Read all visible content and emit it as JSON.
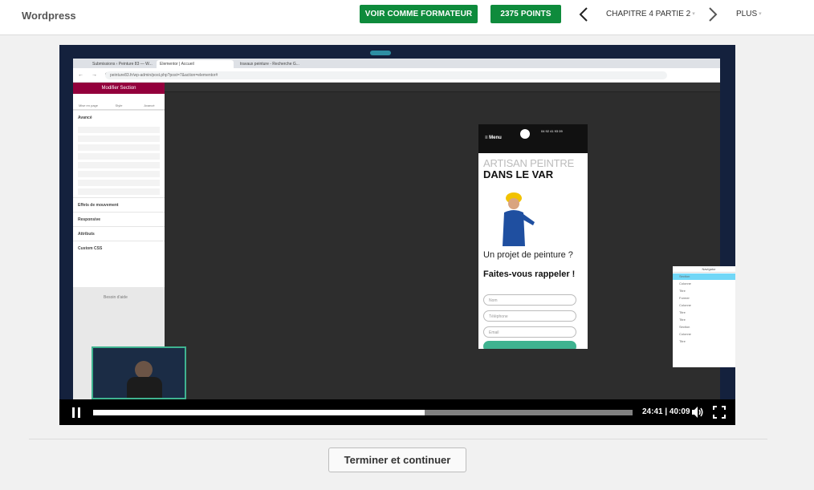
{
  "header": {
    "brand": "Wordpress",
    "trainer_button": "VOIR COMME FORMATEUR",
    "points_button": "2375 POINTS",
    "chapter_label": "CHAPITRE 4 PARTIE 2",
    "more_label": "PLUS"
  },
  "video": {
    "current_time": "24:41",
    "duration": "40:09",
    "time_display": "24:41 | 40:09",
    "progress": 0.615,
    "screen": {
      "tabs": [
        "Submissions ‹ Peinture 83 — W...",
        "Elementor | Accueil",
        "travaux peinture - Recherche G..."
      ],
      "url": "peinture83.fr/wp-admin/post.php?post=7&action=elementor#",
      "panel_title": "Modifier Section",
      "panel_tabs": [
        "Mise en page",
        "Style",
        "Avancé"
      ],
      "panel_sections": [
        "Avancé",
        "Effets de mouvement",
        "Responsive",
        "Attributs",
        "Custom CSS"
      ],
      "panel_footer": "Besoin d'aide",
      "phone": {
        "menu": "Menu",
        "phone_number": "04 92 41 93 09",
        "tagline_light": "ARTISAN PEINTRE",
        "tagline_bold": "DANS LE VAR",
        "question_light": "Un projet de peinture ?",
        "question_bold": "Faites-vous rappeler !",
        "inputs": [
          "Nom",
          "Téléphone",
          "Email"
        ]
      },
      "navigator": {
        "title": "Navigator",
        "rows": [
          "Section",
          "Colonne",
          "Titre",
          "Former",
          "Colonne",
          "Titre",
          "Titre",
          "Section",
          "Colonne",
          "Titre"
        ]
      }
    }
  },
  "footer": {
    "finish_button": "Terminer et continuer"
  }
}
